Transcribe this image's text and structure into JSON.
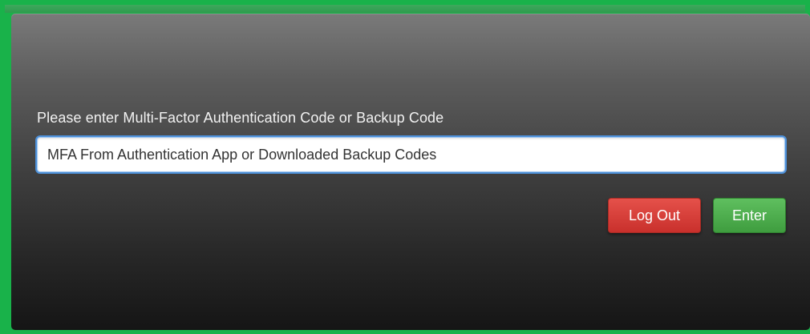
{
  "dialog": {
    "prompt": "Please enter Multi-Factor Authentication Code or Backup Code",
    "input": {
      "value": "MFA From Authentication App or Downloaded Backup Codes",
      "placeholder": "MFA From Authentication App or Downloaded Backup Codes"
    },
    "buttons": {
      "logout_label": "Log Out",
      "enter_label": "Enter"
    }
  },
  "colors": {
    "frame_border": "#19b24a",
    "logout_button": "#d9534f",
    "enter_button": "#4cae4c",
    "input_focus": "#4d90d9"
  }
}
